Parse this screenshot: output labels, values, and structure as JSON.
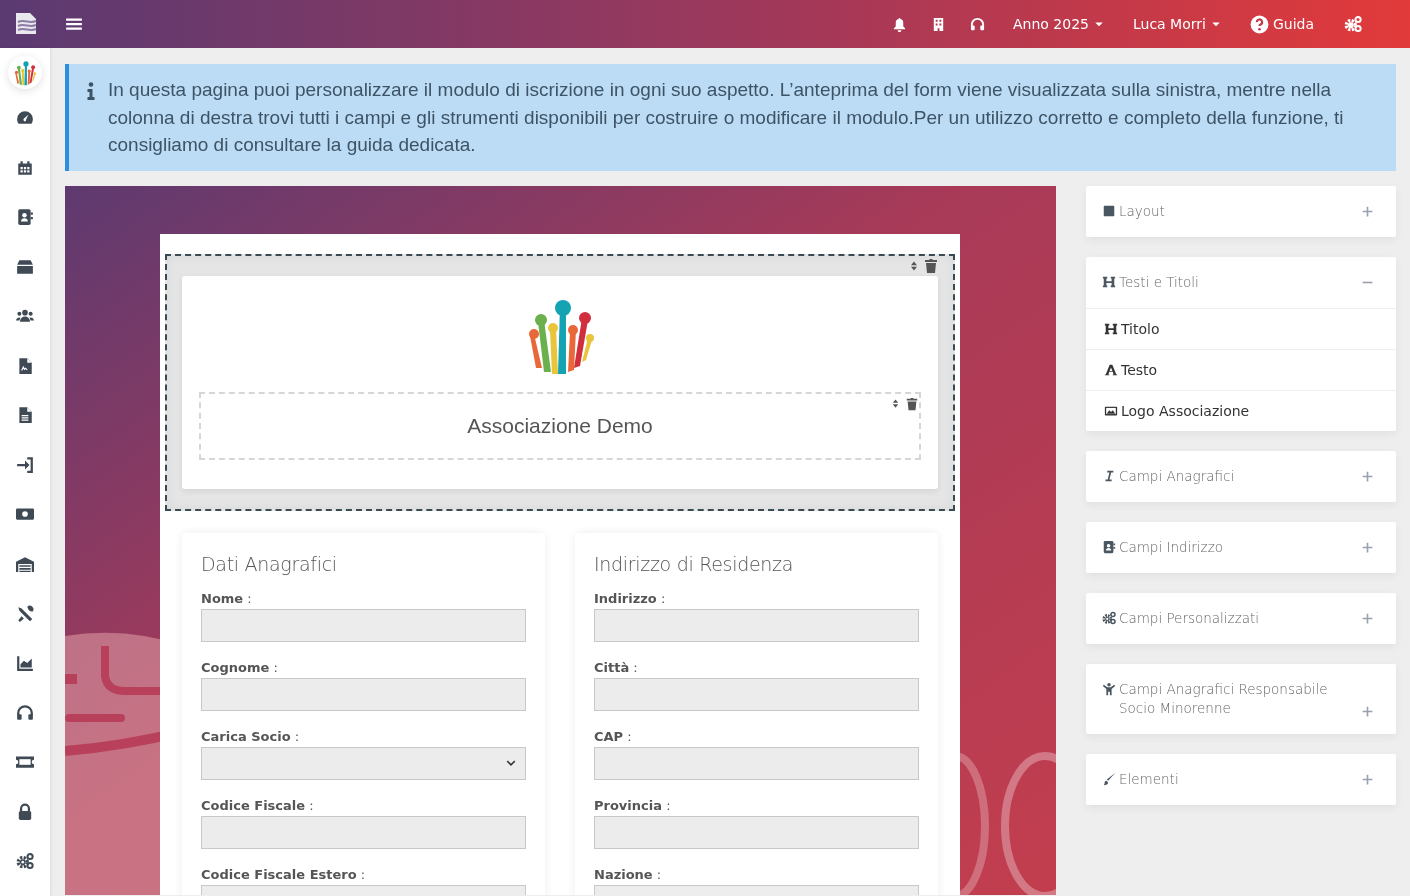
{
  "topbar": {
    "year": "Anno 2025",
    "user": "Luca Morri",
    "help": "Guida"
  },
  "info": "In questa pagina puoi personalizzare il modulo di iscrizione in ogni suo aspetto. L’anteprima del form viene visualizzata sulla sinistra, mentre nella colonna di destra trovi tutti i campi e gli strumenti disponibili per costruire o modificare il modulo.Per un utilizzo corretto e completo della funzione, ti consigliamo di consultare la guida dedicata.",
  "form": {
    "title": "Associazione Demo",
    "sections": [
      {
        "title": "Dati Anagrafici",
        "fields": [
          {
            "label": "**Nome** :",
            "kind": "input"
          },
          {
            "label": "**Cognome** :",
            "kind": "input"
          },
          {
            "label": "**Carica Socio** :",
            "kind": "select"
          },
          {
            "label": "**Codice Fiscale** :",
            "kind": "input"
          },
          {
            "label": "**Codice Fiscale Estero** :",
            "kind": "input"
          }
        ]
      },
      {
        "title": "Indirizzo di Residenza",
        "fields": [
          {
            "label": "**Indirizzo** :",
            "kind": "input"
          },
          {
            "label": "**Città** :",
            "kind": "input"
          },
          {
            "label": "**CAP** :",
            "kind": "input"
          },
          {
            "label": "**Provincia** :",
            "kind": "input"
          },
          {
            "label": "**Nazione** :",
            "kind": "input"
          }
        ]
      }
    ]
  },
  "toolbox": [
    {
      "title": "Layout",
      "expanded": false
    },
    {
      "title": "Testi e Titoli",
      "expanded": true,
      "items": [
        {
          "label": "Titolo"
        },
        {
          "label": "Testo"
        },
        {
          "label": "Logo Associazione"
        }
      ]
    },
    {
      "title": "Campi Anagrafici",
      "expanded": false
    },
    {
      "title": "Campi Indirizzo",
      "expanded": false
    },
    {
      "title": "Campi Personalizzati",
      "expanded": false
    },
    {
      "title": "Campi Anagrafici Responsabile Socio Minorenne",
      "expanded": false
    },
    {
      "title": "Elementi",
      "expanded": false
    }
  ]
}
